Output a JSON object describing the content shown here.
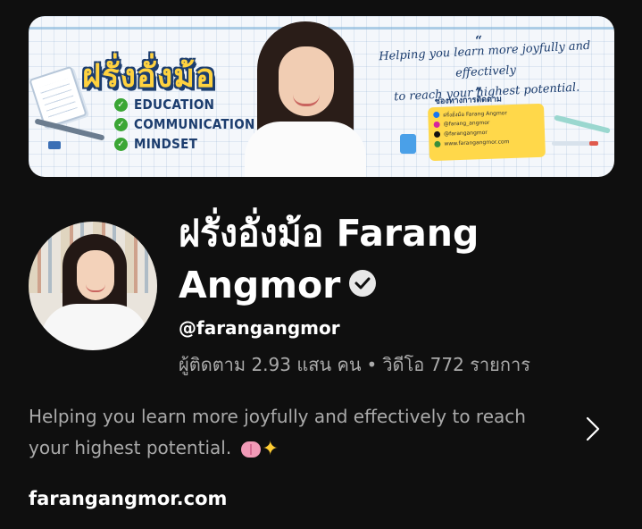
{
  "banner": {
    "title": "ฝรั่งอั่งม้อ",
    "list": [
      "EDUCATION",
      "COMMUNICATION",
      "MINDSET"
    ],
    "quote_line1": "Helping you learn more joyfully and effectively",
    "quote_line2": "to reach your highest potential.",
    "social_heading": "ช่องทางการติดตาม",
    "social": [
      {
        "icon": "facebook-youtube-icon",
        "text": "ฝรั่งอั่งม้อ Farang Angmor",
        "color": "#1877f2"
      },
      {
        "icon": "instagram-icon",
        "text": "@farang_angmor",
        "color": "#d6249f"
      },
      {
        "icon": "tiktok-icon",
        "text": "@farangangmor",
        "color": "#111111"
      },
      {
        "icon": "web-icon",
        "text": "www.farangangmor.com",
        "color": "#3a8f3a"
      }
    ]
  },
  "channel": {
    "name": "ฝรั่งอั่งม้อ Farang Angmor",
    "handle": "@farangangmor",
    "subscribers": "ผู้ติดตาม 2.93 แสน คน",
    "separator": "•",
    "videos": "วิดีโอ 772 รายการ",
    "description": "Helping you learn more joyfully and effectively to reach your highest potential.",
    "link": "farangangmor.com"
  },
  "colors": {
    "background": "#0f0f0f",
    "secondary_text": "#aaaaaa",
    "banner_accent": "#ffd23f",
    "banner_navy": "#1c3d6e"
  }
}
